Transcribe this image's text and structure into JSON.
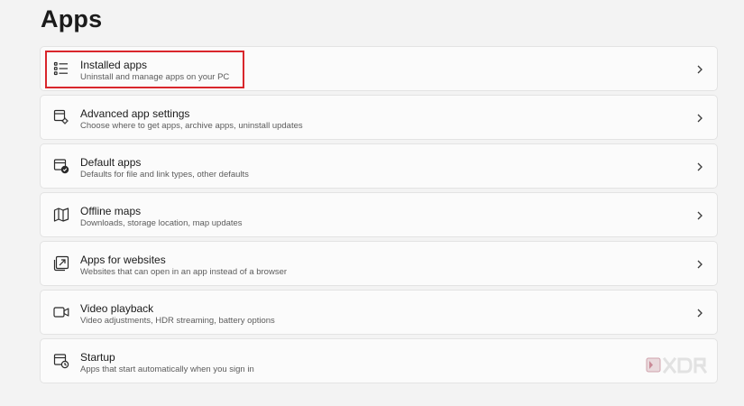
{
  "page": {
    "title": "Apps"
  },
  "items": [
    {
      "title": "Installed apps",
      "subtitle": "Uninstall and manage apps on your PC",
      "icon": "list-icon",
      "highlighted": true
    },
    {
      "title": "Advanced app settings",
      "subtitle": "Choose where to get apps, archive apps, uninstall updates",
      "icon": "app-settings-icon"
    },
    {
      "title": "Default apps",
      "subtitle": "Defaults for file and link types, other defaults",
      "icon": "default-apps-icon"
    },
    {
      "title": "Offline maps",
      "subtitle": "Downloads, storage location, map updates",
      "icon": "map-icon"
    },
    {
      "title": "Apps for websites",
      "subtitle": "Websites that can open in an app instead of a browser",
      "icon": "open-in-app-icon"
    },
    {
      "title": "Video playback",
      "subtitle": "Video adjustments, HDR streaming, battery options",
      "icon": "video-camera-icon"
    },
    {
      "title": "Startup",
      "subtitle": "Apps that start automatically when you sign in",
      "icon": "startup-icon"
    }
  ],
  "watermark": {
    "text": "XDA",
    "icon": "xda-logo-icon"
  },
  "colors": {
    "background": "#f3f3f3",
    "card": "#fbfbfb",
    "card_border": "#e3e3e3",
    "highlight": "#d9262c"
  }
}
